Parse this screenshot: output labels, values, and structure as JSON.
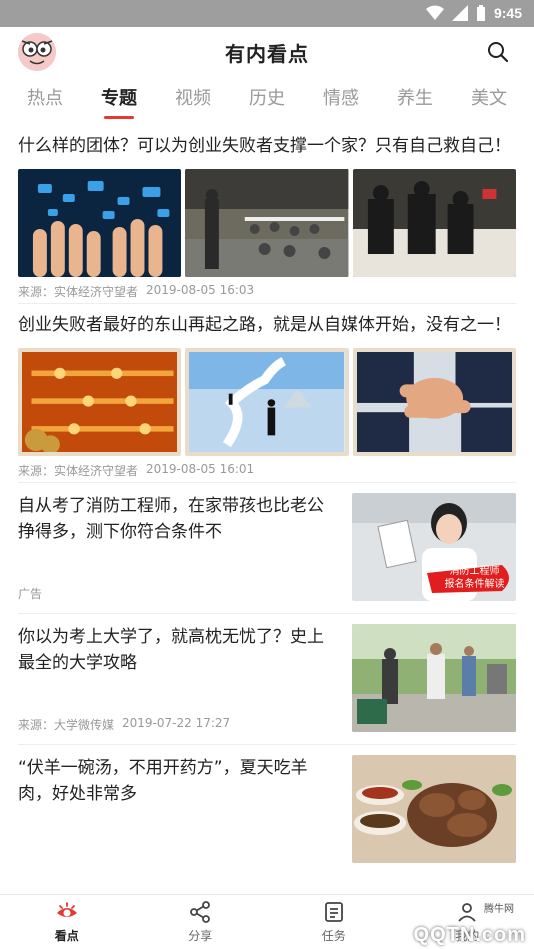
{
  "status": {
    "time": "9:45"
  },
  "header": {
    "title": "有内看点"
  },
  "tabs": [
    "热点",
    "专题",
    "视频",
    "历史",
    "情感",
    "养生",
    "美文"
  ],
  "articles": [
    {
      "title": "什么样的团体？可以为创业失败者支撑一个家？只有自己救自己！",
      "source": "来源：实体经济守望者",
      "time": "2019-08-05 16:03"
    },
    {
      "title": "创业失败者最好的东山再起之路，就是从自媒体开始，没有之一！",
      "source": "来源：实体经济守望者",
      "time": "2019-08-05 16:01"
    },
    {
      "title": "自从考了消防工程师，在家带孩也比老公挣得多，测下你符合条件不",
      "source": "广告",
      "time": "",
      "thumb_caption": [
        "消防工程师",
        "报名条件解读"
      ]
    },
    {
      "title": "你以为考上大学了，就高枕无忧了？史上最全的大学攻略",
      "source": "来源：大学微传媒",
      "time": "2019-07-22 17:27"
    },
    {
      "title": "“伏羊一碗汤，不用开药方”，夏天吃羊肉，好处非常多",
      "source": "",
      "time": ""
    }
  ],
  "nav": [
    {
      "label": "看点",
      "icon": "eye-icon"
    },
    {
      "label": "分享",
      "icon": "share-icon"
    },
    {
      "label": "任务",
      "icon": "task-icon"
    },
    {
      "label": "我的",
      "icon": "profile-icon"
    }
  ],
  "watermark": {
    "main": "QQTN.com",
    "small": "腾牛网"
  },
  "colors": {
    "accent": "#e53935",
    "statusbar": "#9e9e9e"
  }
}
